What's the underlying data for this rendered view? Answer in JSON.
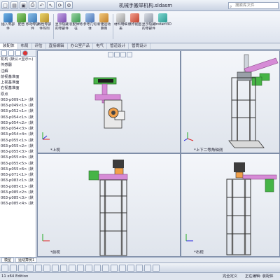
{
  "title_bar": {
    "document_title": "机械手搬举机构.sldasm",
    "search_placeholder": "搜索库文件"
  },
  "ribbon": {
    "buttons": [
      {
        "label": "插入零部件"
      },
      {
        "label": "配合"
      },
      {
        "label": "线性零部件阵列"
      },
      {
        "label": "移动零部件"
      },
      {
        "label": "显示隐藏的零部件"
      },
      {
        "label": "装配体特征"
      },
      {
        "label": "参考几何体"
      },
      {
        "label": "新建运动算例"
      },
      {
        "label": "材料明细表"
      },
      {
        "label": "爆炸视图"
      },
      {
        "label": "显示隐藏的零部件"
      },
      {
        "label": "Instant3D"
      }
    ]
  },
  "tabs": [
    "装配体",
    "布局",
    "评估",
    "直接编辑",
    "办公室产品",
    "电气",
    "管道设计",
    "管筒设计"
  ],
  "feature_tree": {
    "items": [
      "机构 (默认<显示>)",
      "传感器",
      "注解",
      "前视基准面",
      "上视基准面",
      "右视基准面",
      "原点",
      "063-p009<1> (默",
      "063-p049<1> (默",
      "063-p052<1> (默",
      "063-p054<1> (默",
      "063-p054<2> (默",
      "063-p054<3> (默",
      "063-p054<4> (默",
      "063-p055<1> (默",
      "063-p055<2> (默",
      "063-p055<3> (默",
      "063-p055<4> (默",
      "063-p055<5> (默",
      "063-p055<6> (默",
      "063-p071<1> (默",
      "063-p083<1> (默",
      "063-p085<1> (默",
      "063-p085<2> (默",
      "063-p085<3> (默",
      "063-p085<4> (默"
    ]
  },
  "viewports": [
    {
      "label": "*上视"
    },
    {
      "label": "*上下二等角轴测"
    },
    {
      "label": "*前视"
    },
    {
      "label": "*右视"
    }
  ],
  "bottom_tabs": [
    "模型",
    "运动算例1"
  ],
  "status": {
    "left": "11 x64 Edition",
    "mid": "完全定义",
    "right": "正在编辑: 装配体"
  },
  "colors": {
    "frame": "#5a5f6a",
    "accent_pink": "#d68bd6",
    "accent_green": "#46b446",
    "dark_part": "#3c3c3c"
  }
}
